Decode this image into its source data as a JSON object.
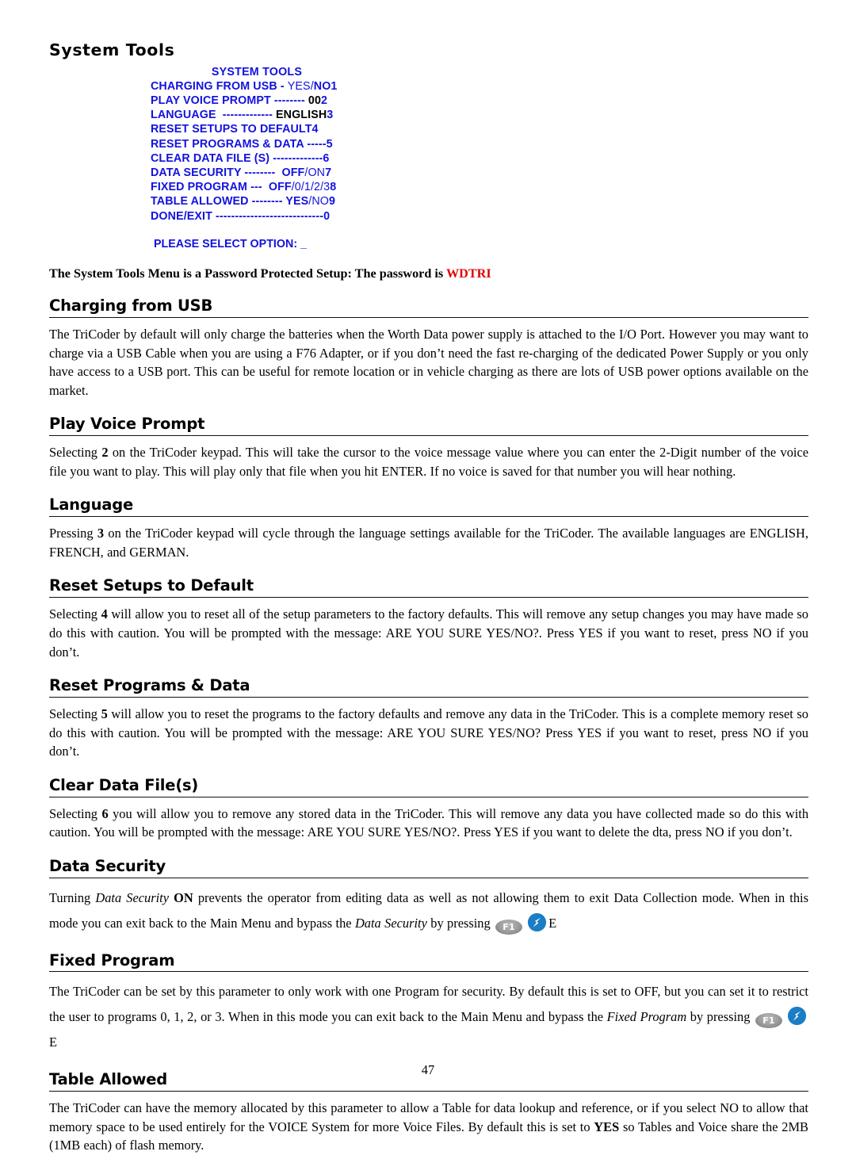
{
  "document": {
    "title": "System Tools",
    "page_number": "47"
  },
  "terminal_menu": {
    "title": "SYSTEM TOOLS",
    "lines": [
      {
        "label": "CHARGING FROM USB - ",
        "value_alt": "YES",
        "sep": "/",
        "value_bold": "NO",
        "index": "1"
      },
      {
        "label": "PLAY VOICE PROMPT -------- ",
        "value_black": "00",
        "index": "2"
      },
      {
        "label": "LANGUAGE  ------------- ",
        "value_black": "ENGLISH",
        "index": "3"
      },
      {
        "label": "RESET SETUPS TO DEFAULT",
        "index": "4"
      },
      {
        "label": "RESET PROGRAMS & DATA -----",
        "index": "5"
      },
      {
        "label": "CLEAR DATA FILE (S) -------------",
        "index": "6"
      },
      {
        "label": "DATA SECURITY --------  ",
        "value_bold": "OFF",
        "sep": "/",
        "value_alt": "ON",
        "index": "7"
      },
      {
        "label": "FIXED PROGRAM ---  ",
        "value_bold": "OFF",
        "sep": "",
        "value_alt": "/0/1/2/3",
        "index": "8"
      },
      {
        "label": "TABLE ALLOWED -------- ",
        "value_bold": "YES",
        "sep": "/",
        "value_alt": "NO",
        "index": "9"
      },
      {
        "label": "DONE/EXIT ----------------------------",
        "index": "0"
      }
    ],
    "prompt": "PLEASE SELECT OPTION: _",
    "colors": {
      "menu_blue": "#1212E0",
      "value_black": "#000000",
      "password_red": "#E00000"
    }
  },
  "password_note": {
    "text_before": "The System Tools Menu is a Password Protected Setup: The password is ",
    "password": "WDTRI"
  },
  "sections": [
    {
      "heading": "Charging from USB",
      "body": "The TriCoder by default will only charge the batteries when the Worth Data power supply is attached to the I/O Port.  However you may want to charge via a USB Cable when you are using a F76 Adapter, or if you don’t need the fast re-charging of the dedicated Power Supply or you only have access to a USB port.  This can be useful for remote location or in vehicle charging as there are lots of USB power options available on the market."
    },
    {
      "heading": "Play Voice Prompt",
      "body_before": "Selecting ",
      "body_bold": "2",
      "body_after": " on the TriCoder keypad.  This will take the cursor to the voice message value where you can enter the 2-Digit number of the voice file you want to play.  This will play only that file when you hit ENTER.  If no voice is saved for that number you will hear nothing."
    },
    {
      "heading": "Language",
      "body_before": "Pressing ",
      "body_bold": "3",
      "body_after": " on the TriCoder keypad will cycle through the language settings available for the TriCoder.  The available languages are ENGLISH, FRENCH, and GERMAN."
    },
    {
      "heading": "Reset Setups to Default",
      "body_before": "Selecting ",
      "body_bold": "4",
      "body_after": " will allow you to reset all of the setup parameters to the factory defaults.  This will remove any setup changes you may have made so do this with caution. You will be prompted with the message: ARE YOU SURE YES/NO?.  Press YES if you want to reset, press NO if you don’t."
    },
    {
      "heading": "Reset Programs & Data",
      "body_before": "Selecting ",
      "body_bold": "5",
      "body_after": " will allow you to reset the programs to the factory defaults and remove any data in the TriCoder.  This is a complete memory reset so do this with caution. You will be prompted with the message: ARE YOU SURE YES/NO?  Press YES if you want to reset, press NO if you don’t."
    },
    {
      "heading": "Clear Data File(s)",
      "body_before": "Selecting ",
      "body_bold": "6",
      "body_after": " you will allow you to remove any stored data in the TriCoder.  This will remove any data you have collected made so do this with caution. You will be prompted with the message: ARE YOU SURE YES/NO?.  Press YES if you want to delete the dta, press NO if you don’t."
    },
    {
      "heading": "Data Security",
      "ds_p1": "Turning ",
      "ds_italic1": "Data Security",
      "ds_p2": " ",
      "ds_bold1": "ON",
      "ds_p3": " prevents the operator from editing data as well as not allowing them to exit Data Collection mode. When in this mode you can exit back to the Main Menu and bypass the ",
      "ds_italic2": "Data Security",
      "ds_p4": " by pressing "
    },
    {
      "heading": "Fixed Program",
      "fp_p1": "The TriCoder can be set by this parameter to only work with one Program for security.  By default this is set to OFF, but you can set it to restrict the user to programs 0, 1, 2, or 3. When in this mode you can exit back to the Main Menu and bypass the ",
      "fp_italic": "Fixed Program",
      "fp_p2": " by pressing "
    },
    {
      "heading": "Table Allowed",
      "ta_p1": "The TriCoder can have the memory allocated by this parameter to allow a Table for data lookup and reference, or if you select NO to allow that memory space to be used entirely for the VOICE System for more Voice Files.  By default this is set to ",
      "ta_bold": "YES",
      "ta_p2": " so Tables and Voice share the 2MB (1MB each) of flash memory."
    }
  ],
  "key_icons": {
    "f1_label": "F1",
    "e_label": "E",
    "arrow_name": "blue-arrow-key"
  }
}
